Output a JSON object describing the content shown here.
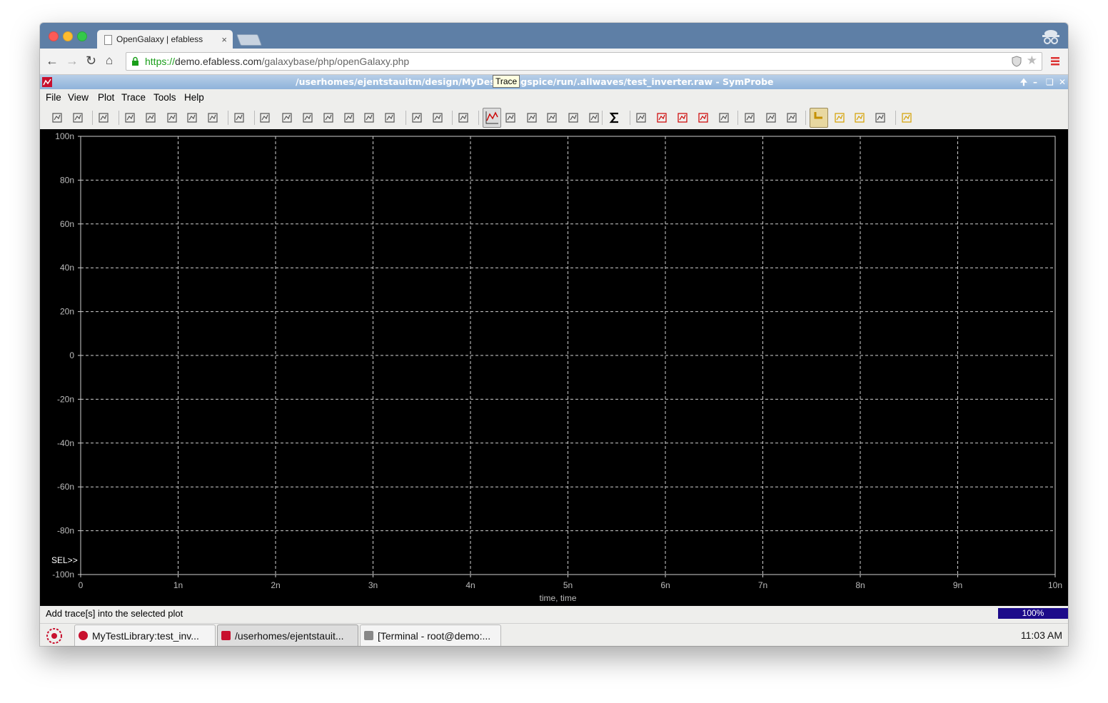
{
  "browser": {
    "tab_title": "OpenGalaxy | efabless",
    "tab_close": "×",
    "url_scheme": "https://",
    "url_host": "demo.efabless.com",
    "url_path": "/galaxybase/php/openGalaxy.php"
  },
  "app": {
    "title": "/userhomes/ejentstauitm/design/MyDesign/ngspice/run/.allwaves/test_inverter.raw - SymProbe",
    "menus": [
      "File",
      "View",
      "Plot",
      "Trace",
      "Tools",
      "Help"
    ],
    "tooltip": "Trace"
  },
  "plot": {
    "sel_label": "SEL>>",
    "status": "Add trace[s] into the selected plot",
    "progress": "100%"
  },
  "chart_data": {
    "type": "line",
    "series": [],
    "xlabel": "time, time",
    "x_tick_labels": [
      "0",
      "1n",
      "2n",
      "3n",
      "4n",
      "5n",
      "6n",
      "7n",
      "8n",
      "9n",
      "10n"
    ],
    "y_tick_labels": [
      "100n",
      "80n",
      "60n",
      "40n",
      "20n",
      "0",
      "-20n",
      "-40n",
      "-60n",
      "-80n",
      "-100n"
    ],
    "xlim": [
      0,
      1e-08
    ],
    "ylim": [
      -1e-07,
      1e-07
    ],
    "grid": true,
    "background": "#000000",
    "grid_color": "#d0d0d0"
  },
  "taskbar": {
    "tasks": [
      "MyTestLibrary:test_inv...",
      "/userhomes/ejentstauit...",
      "[Terminal - root@demo:..."
    ],
    "clock": "11:03 AM"
  },
  "icons": {
    "toolbar": [
      "open-icon",
      "save-icon",
      "print-icon",
      "undo-icon",
      "redo-icon",
      "zoom-in-icon",
      "zoom-out-icon",
      "zoom-fit-icon",
      "cursor-icon",
      "split-h-icon",
      "split-v-icon",
      "stack-icon",
      "stack2-icon",
      "up-icon",
      "down-icon",
      "wave-icon",
      "copy-plot-icon",
      "paste-plot-icon",
      "move-icon",
      "trace-icon",
      "bus-icon",
      "copy-icon",
      "paste-icon",
      "edit-icon",
      "bar-icon",
      "sigma-icon",
      "eye-icon",
      "histogram-icon",
      "fft-icon",
      "spectrum-icon",
      "xy-icon",
      "grid-icon",
      "columns-icon",
      "rows-icon",
      "marker-icon",
      "measure-icon",
      "label-icon",
      "probe-icon",
      "person-icon"
    ]
  }
}
